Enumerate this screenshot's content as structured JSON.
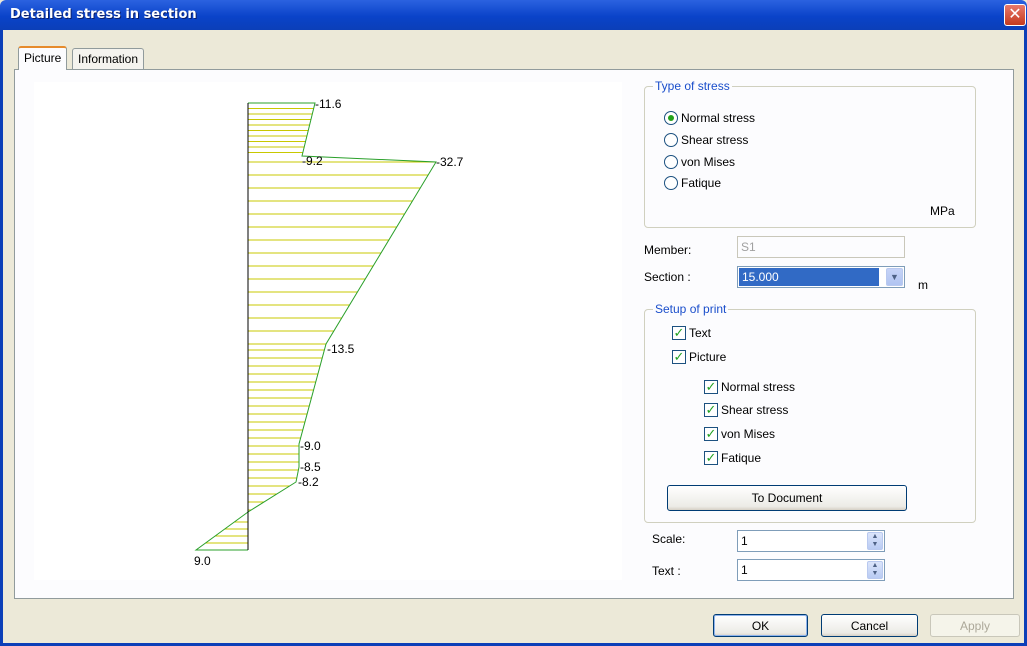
{
  "window": {
    "title": "Detailed stress in section"
  },
  "tabs": [
    {
      "label": "Picture"
    },
    {
      "label": "Information"
    }
  ],
  "diagram": {
    "labels": [
      "-11.6",
      "-9.2",
      "-32.7",
      "-13.5",
      "-9.0",
      "-8.5",
      "-8.2",
      "9.0"
    ],
    "colors": {
      "hatch": "#c8c800",
      "outline": "#2ba02b"
    }
  },
  "type_of_stress": {
    "title": "Type of stress",
    "options": [
      "Normal stress",
      "Shear stress",
      "von Mises",
      "Fatique"
    ],
    "selected": "Normal stress",
    "unit": "MPa"
  },
  "member": {
    "label": "Member:",
    "value": "S1"
  },
  "section": {
    "label": "Section :",
    "value": "15.000",
    "unit": "m"
  },
  "setup_of_print": {
    "title": "Setup of print",
    "text_label": "Text",
    "picture_label": "Picture",
    "sub_items": [
      "Normal stress",
      "Shear stress",
      "von Mises",
      "Fatique"
    ],
    "to_document_label": "To Document"
  },
  "scale": {
    "label": "Scale:",
    "value": "1"
  },
  "text_size": {
    "label": "Text :",
    "value": "1"
  },
  "footer": {
    "ok": "OK",
    "cancel": "Cancel",
    "apply": "Apply"
  }
}
